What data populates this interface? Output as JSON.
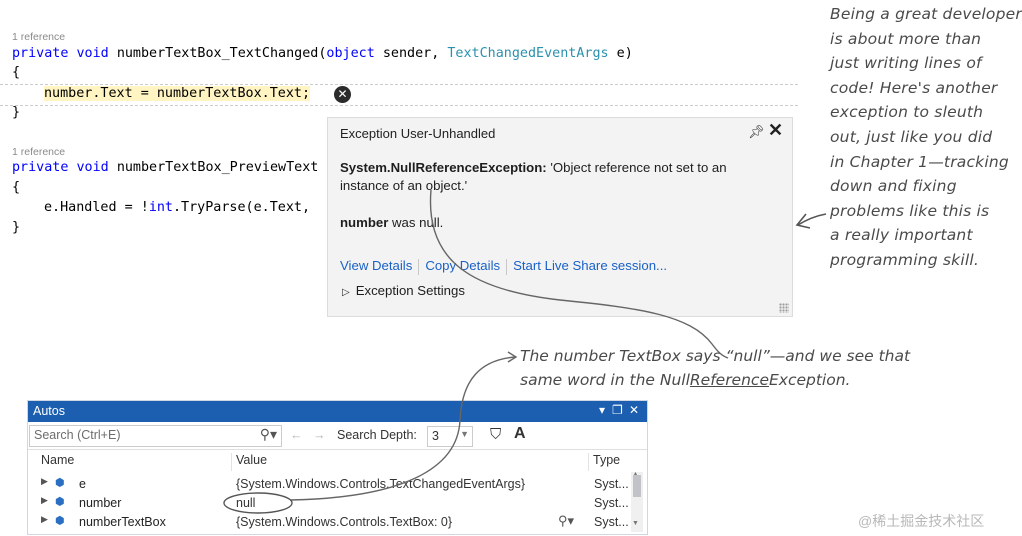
{
  "code": {
    "ref1": "1 reference",
    "l1_kw": "private void ",
    "l1_name": "numberTextBox_TextChanged",
    "l1_paren": "(",
    "l1_obj": "object",
    "l1_sender": " sender, ",
    "l1_type": "TextChangedEventArgs",
    "l1_end": " e)",
    "l2": "{",
    "l3_var": "number",
    "l3_rest": ".Text = numberTextBox.Text;",
    "l4": "}",
    "ref2": "1 reference",
    "l5_kw": "private void ",
    "l5_name": "numberTextBox_PreviewText",
    "l6": "{",
    "l7_a": "e.Handled = !",
    "l7_int": "int",
    "l7_b": ".TryParse(e.Text, ",
    "l8": "}"
  },
  "exception_popup": {
    "title": "Exception User-Unhandled",
    "pin_icon": "pin-icon",
    "close_icon": "close-icon",
    "type_prefix": "System.",
    "type_name": "NullReferenceException:",
    "message": " 'Object reference not set to an instance of an object.'",
    "null_var": "number",
    "null_rest": " was null.",
    "link_view": "View Details",
    "link_copy": "Copy Details",
    "link_share": "Start Live Share session...",
    "settings_arrow": "▷",
    "settings": "Exception Settings"
  },
  "annotations": {
    "right_lines": [
      "Being a great developer",
      "is about more than",
      "just writing lines of",
      "code! Here's another",
      "exception to sleuth",
      "out, just like you did",
      "in Chapter 1—tracking",
      "down and fixing",
      "problems like this is",
      "a really important",
      "programming skill."
    ],
    "mid_line1": "The number TextBox says “null”—and we see that",
    "mid_line2_a": "same word in the Null",
    "mid_line2_u": "Reference",
    "mid_line2_b": "Exception."
  },
  "autos": {
    "title": "Autos",
    "search_placeholder": "Search (Ctrl+E)",
    "search_depth_label": "Search Depth:",
    "search_depth_value": "3",
    "col_name": "Name",
    "col_value": "Value",
    "col_type": "Type",
    "rows": [
      {
        "name": "e",
        "value": "{System.Windows.Controls.TextChangedEventArgs}",
        "type": "Syst..."
      },
      {
        "name": "number",
        "value": "null",
        "type": "Syst..."
      },
      {
        "name": "numberTextBox",
        "value": "{System.Windows.Controls.TextBox: 0}",
        "type": "Syst..."
      }
    ]
  },
  "watermark": "@稀土掘金技术社区",
  "colors": {
    "keyword": "#0000ff",
    "type": "#2b91af",
    "link": "#1a61c7",
    "titlebar": "#1c5fb0",
    "highlight": "#fff4c2"
  }
}
